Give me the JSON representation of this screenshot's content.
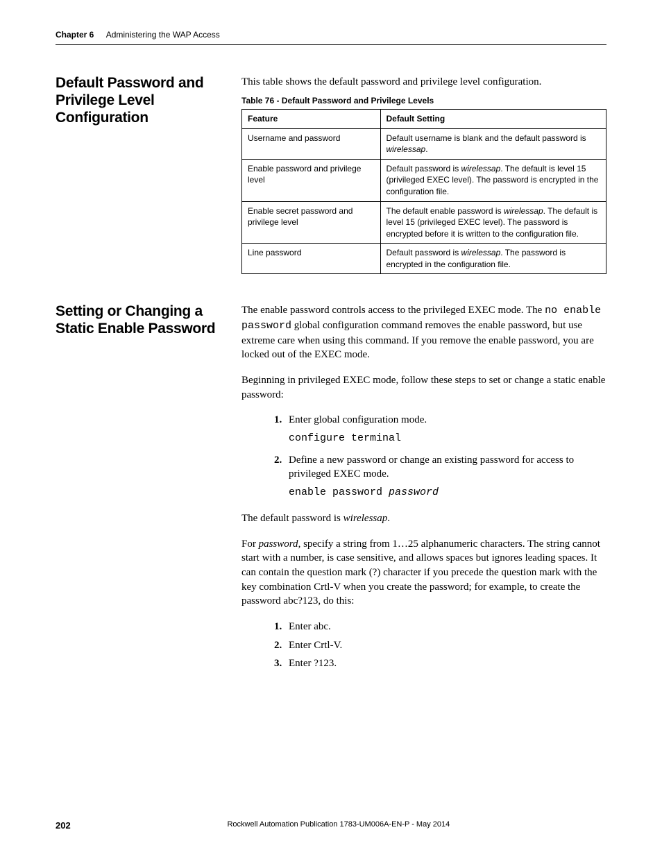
{
  "header": {
    "chapter_label": "Chapter 6",
    "chapter_title": "Administering the WAP Access"
  },
  "section1": {
    "heading": "Default Password and Privilege Level Configuration",
    "intro": "This table shows the default password and privilege level configuration.",
    "table_caption": "Table 76 - Default Password and Privilege Levels",
    "table": {
      "header_feature": "Feature",
      "header_default": "Default Setting",
      "rows": [
        {
          "feature": "Username and password",
          "setting_pre": "Default username is blank and the default password is ",
          "setting_em": "wirelessap",
          "setting_post": "."
        },
        {
          "feature": "Enable password and privilege level",
          "setting_pre": "Default password is ",
          "setting_em": "wirelessap",
          "setting_post": ". The default is level 15 (privileged EXEC level). The password is encrypted in the configuration file."
        },
        {
          "feature": "Enable secret password and privilege level",
          "setting_pre": "The default enable password is ",
          "setting_em": "wirelessap",
          "setting_post": ". The default is level 15 (privileged EXEC level). The password is encrypted before it is written to the configuration file."
        },
        {
          "feature": "Line password",
          "setting_pre": "Default password is ",
          "setting_em": "wirelessap",
          "setting_post": ". The password is encrypted in the configuration file."
        }
      ]
    }
  },
  "section2": {
    "heading": "Setting or Changing a Static Enable Password",
    "p1_a": "The enable password controls access to the privileged EXEC mode. The ",
    "p1_code": "no enable password",
    "p1_b": " global configuration command removes the enable password, but use extreme care when using this command. If you remove the enable password, you are locked out of the EXEC mode.",
    "p2": "Beginning in privileged EXEC mode, follow these steps to set or change a static enable password:",
    "steps": [
      {
        "text": "Enter global configuration mode.",
        "code": "configure terminal"
      },
      {
        "text": "Define a new password or change an existing password for access to privileged EXEC mode.",
        "code_pre": "enable password ",
        "code_arg": "password"
      }
    ],
    "p3_a": "The default password is ",
    "p3_em": "wirelessap",
    "p3_b": ".",
    "p4_a": "For ",
    "p4_em": "password",
    "p4_b": ", specify a string from 1…25 alphanumeric characters. The string cannot start with a number, is case sensitive, and allows spaces but ignores leading spaces. It can contain the question mark (?) character if you precede the question mark with the key combination Crtl-V when you create the password; for example, to create the password abc?123, do this:",
    "substeps": [
      "Enter abc.",
      "Enter Crtl-V.",
      "Enter ?123."
    ]
  },
  "footer": {
    "page_number": "202",
    "publication": "Rockwell Automation Publication 1783-UM006A-EN-P - May 2014"
  }
}
